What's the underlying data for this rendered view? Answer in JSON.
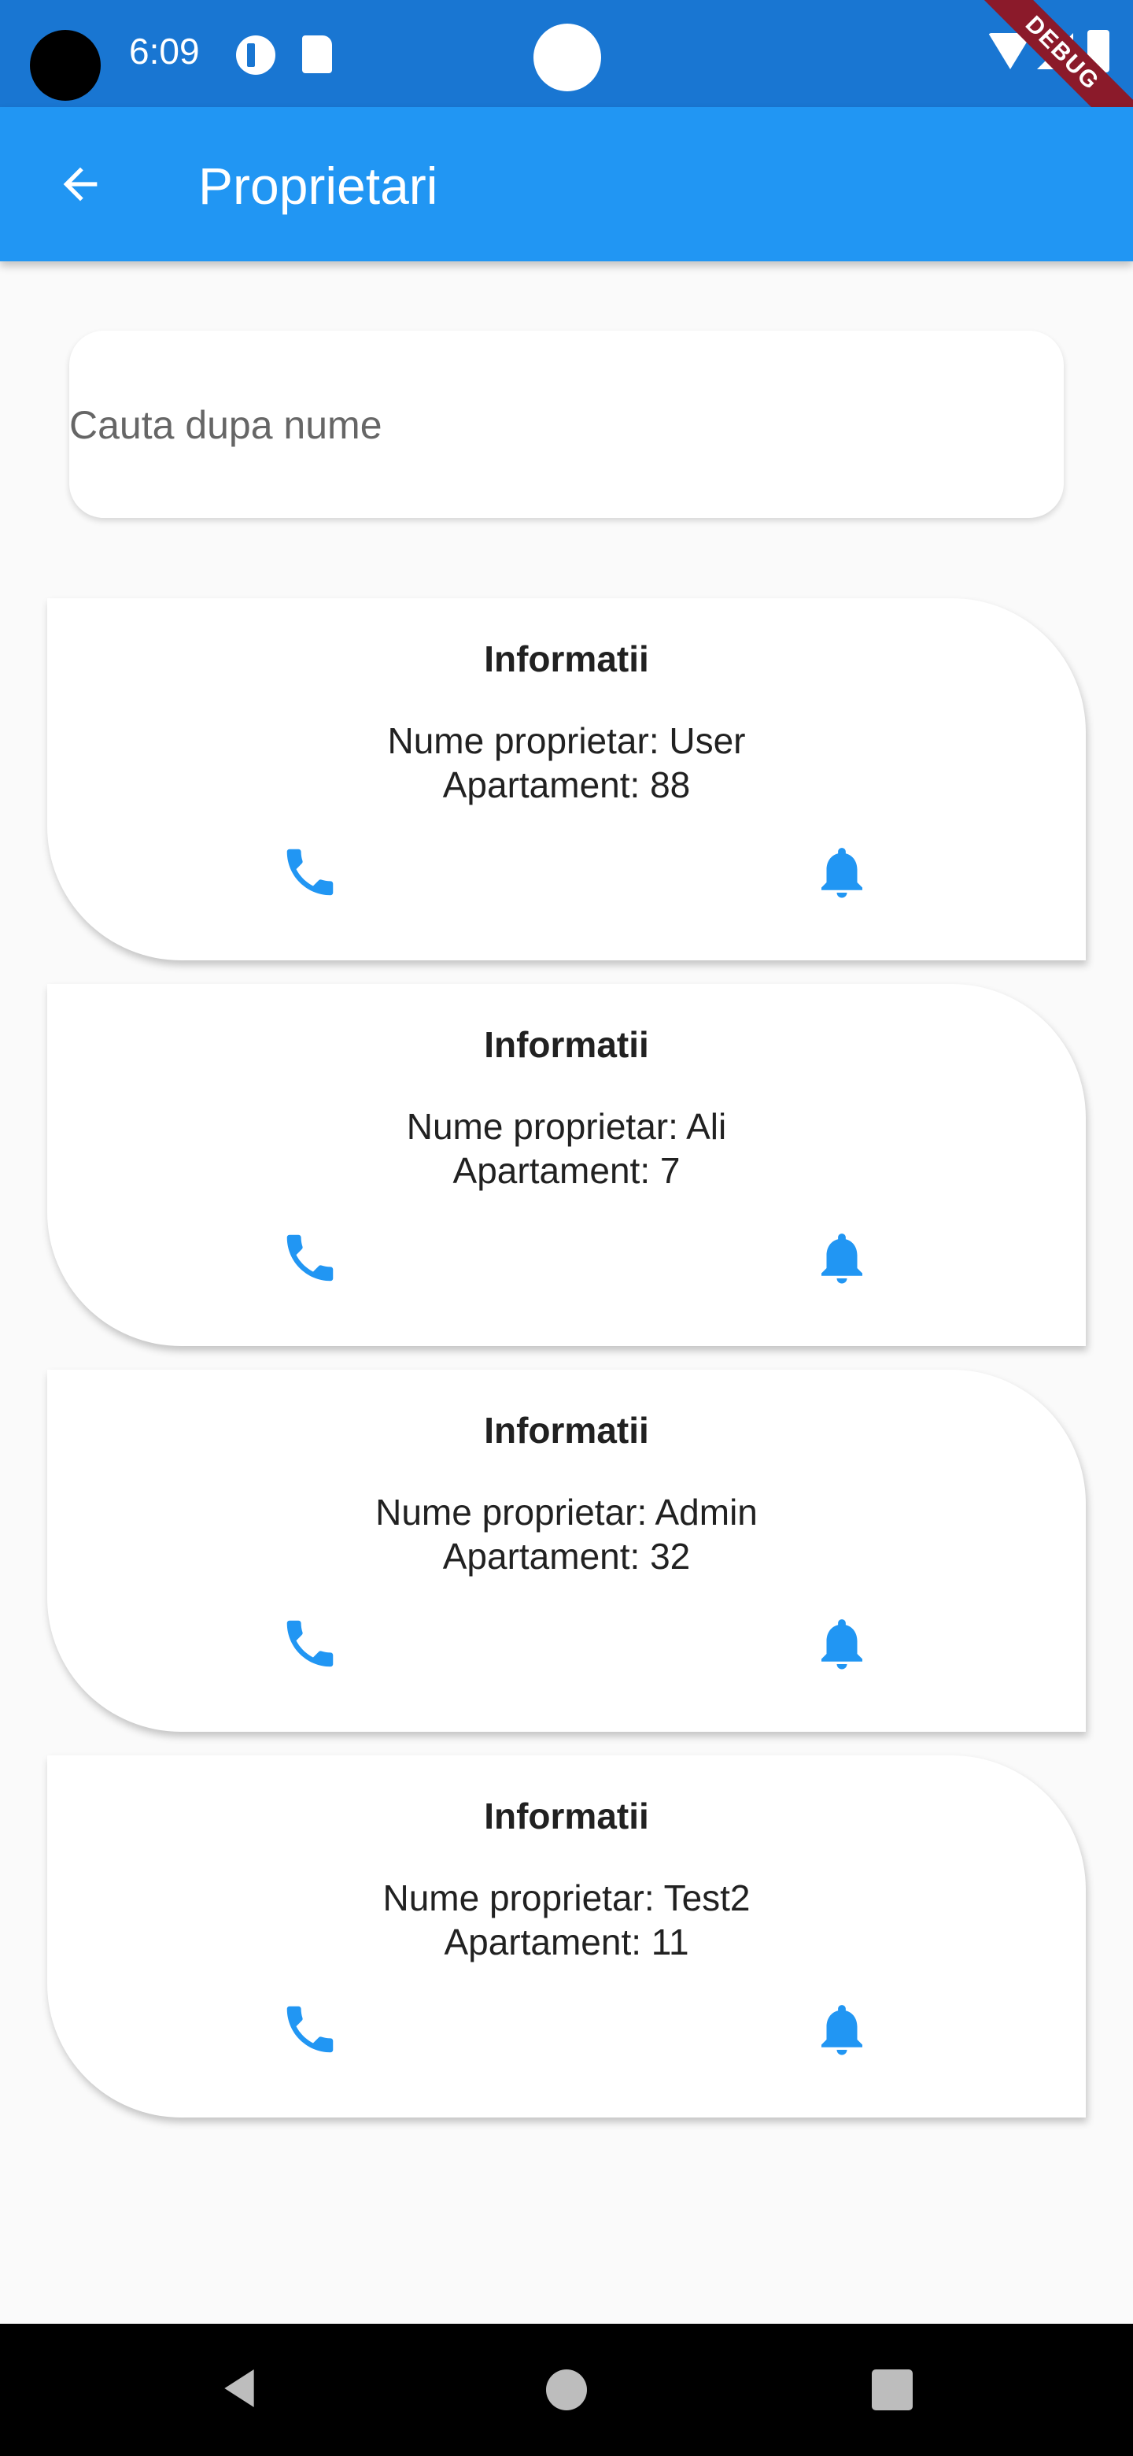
{
  "status_bar": {
    "time": "6:09",
    "debug_label": "DEBUG"
  },
  "app_bar": {
    "title": "Proprietari",
    "back_icon": "arrow-back-icon",
    "background_color": "#2196f3"
  },
  "search": {
    "placeholder": "Cauta dupa nume",
    "value": ""
  },
  "owners": [
    {
      "title": "Informatii",
      "owner": "Nume proprietar: User",
      "apartment": "Apartament: 88"
    },
    {
      "title": "Informatii",
      "owner": "Nume proprietar: Ali",
      "apartment": "Apartament: 7"
    },
    {
      "title": "Informatii",
      "owner": "Nume proprietar: Admin",
      "apartment": "Apartament: 32"
    },
    {
      "title": "Informatii",
      "owner": "Nume proprietar: Test2",
      "apartment": "Apartament: 11"
    }
  ],
  "icons": {
    "call": "phone-icon",
    "notify": "bell-icon",
    "accent_color": "#2196f3"
  },
  "nav_bar": {
    "back": "nav-back-icon",
    "home": "nav-home-icon",
    "recents": "nav-recents-icon"
  }
}
